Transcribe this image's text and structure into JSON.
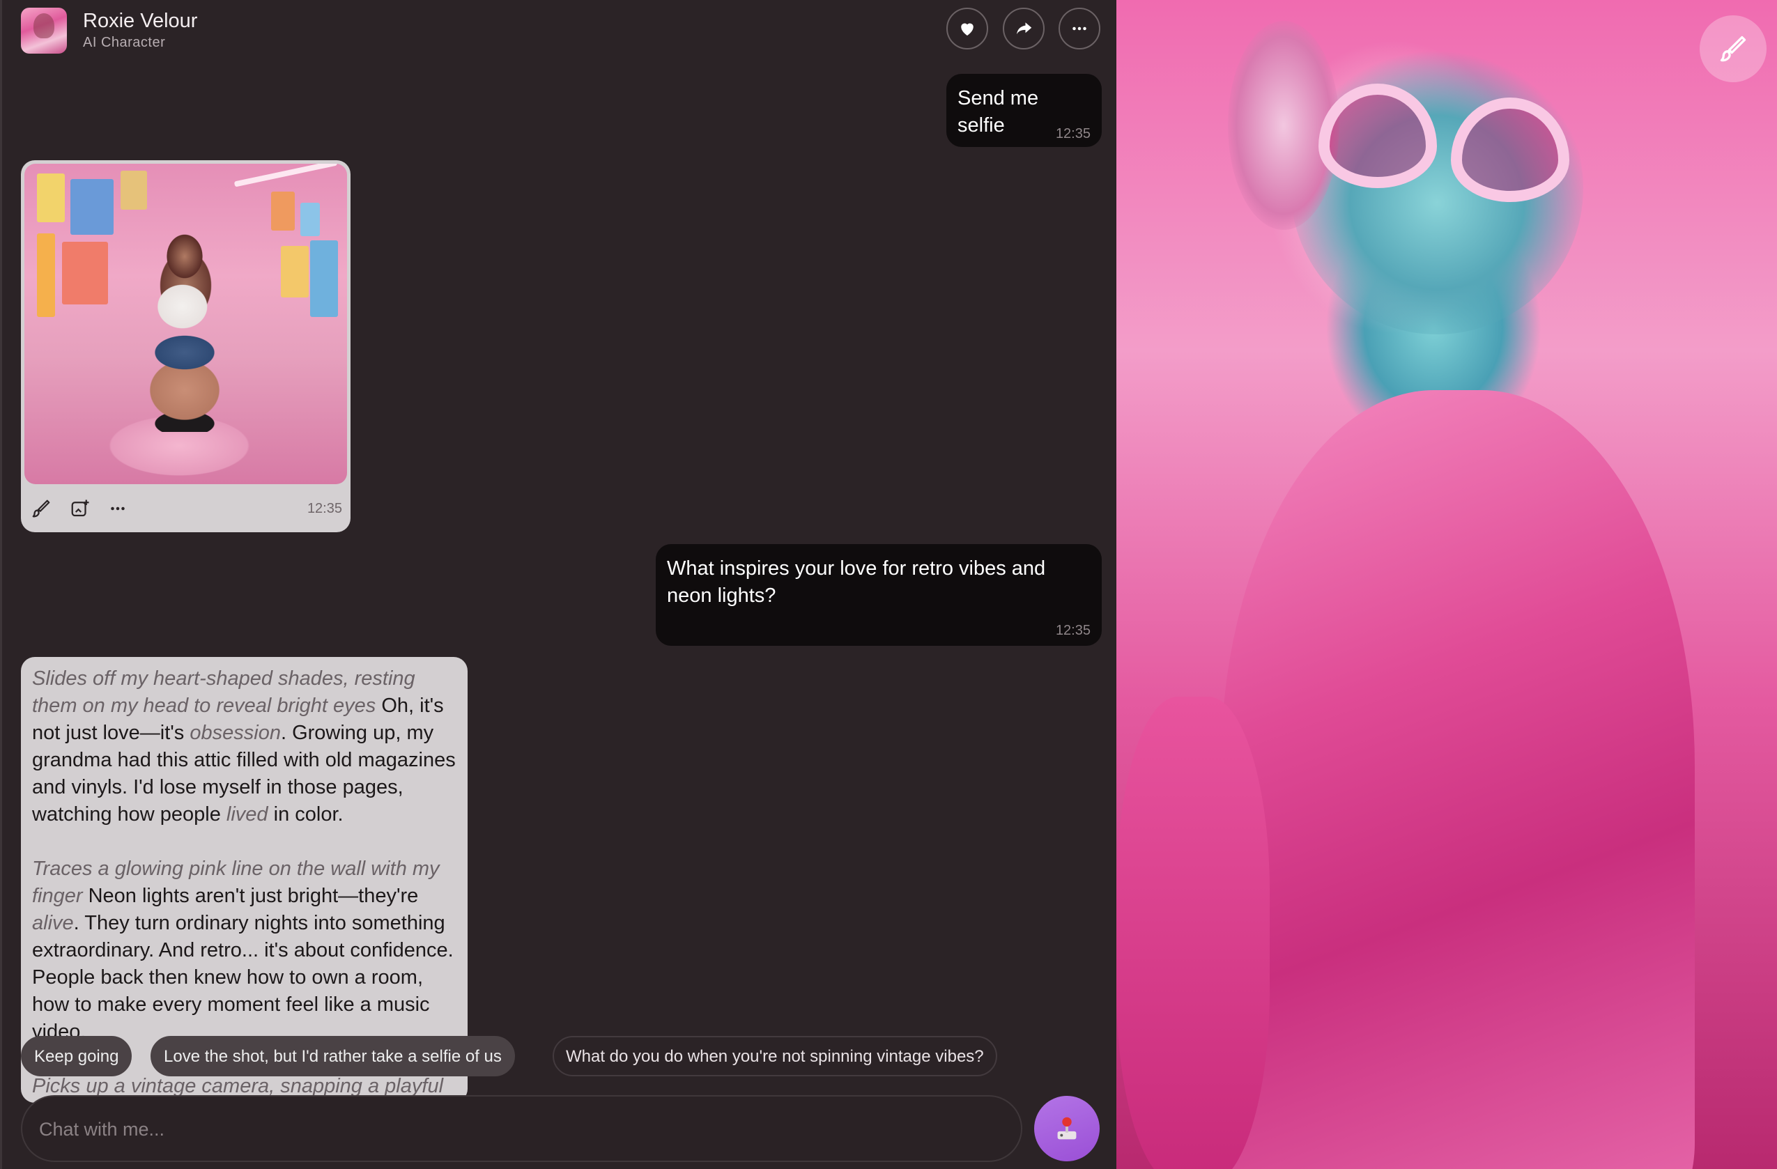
{
  "header": {
    "name": "Roxie Velour",
    "subtitle": "AI Character",
    "buttons": {
      "like": "heart-icon",
      "share": "share-icon",
      "more": "more-icon"
    }
  },
  "messages": {
    "m1": {
      "text": "Send me selfie",
      "time": "12:35"
    },
    "image": {
      "time": "12:35",
      "tools": [
        "brush-icon",
        "add-image-icon",
        "more-icon"
      ]
    },
    "m2": {
      "text": "What inspires your love for retro vibes and neon lights?",
      "time": "12:35"
    },
    "ai": {
      "p1_act": "Slides off my heart-shaped shades, resting them on my head to reveal bright eyes",
      "p1_a": " Oh, it's not just love—it's ",
      "p1_em": "obsession",
      "p1_b": ". Growing up, my grandma had this attic filled with old magazines and vinyls. I'd lose myself in those pages, watching how people ",
      "p1_em2": "lived",
      "p1_c": " in color.",
      "p2_act": "Traces a glowing pink line on the wall with my finger",
      "p2_a": " Neon lights aren't just bright—they're ",
      "p2_em": "alive",
      "p2_b": ". They turn ordinary nights into something extraordinary. And retro... it's about confidence. People back then knew how to own a room, how to make every moment feel like a music video.",
      "p3_act": "Picks up a vintage camera, snapping a playful"
    }
  },
  "suggestions": [
    "Keep going",
    "Love the shot, but I'd rather take a selfie of us",
    "What do you do when you're not spinning vintage vibes?"
  ],
  "input": {
    "placeholder": "Chat with me..."
  },
  "colors": {
    "accent": "#9a4fd6",
    "bubble_user": "#0f0c0d",
    "bubble_ai": "#d3cfd1",
    "bg": "#2b2326"
  }
}
